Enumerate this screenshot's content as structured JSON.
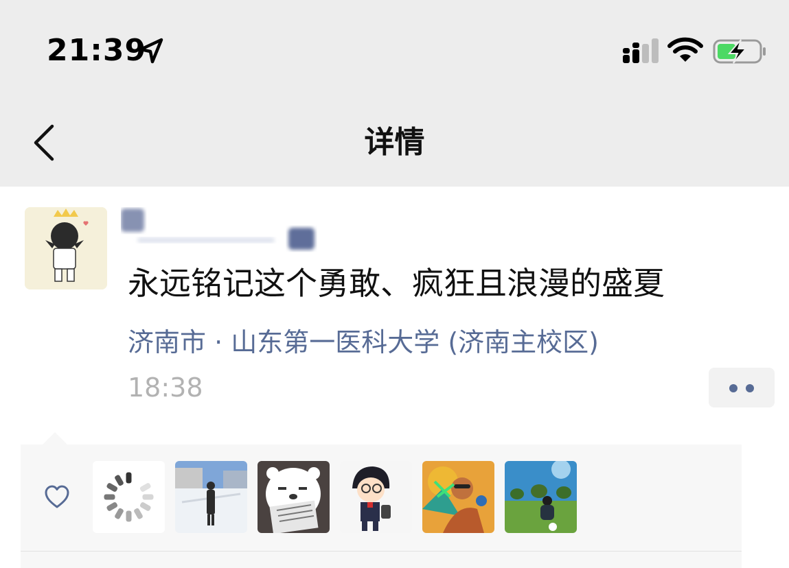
{
  "status_bar": {
    "time": "21:39",
    "location_icon": "location-arrow-icon",
    "signal_icon": "cellular-signal-icon",
    "wifi_icon": "wifi-icon",
    "battery_icon": "battery-charging-icon",
    "battery_color": "#4cd964"
  },
  "nav": {
    "back_icon": "chevron-left-icon",
    "title": "详情"
  },
  "post": {
    "text": "永远铭记这个勇敢、疯狂且浪漫的盛夏",
    "location": "济南市 · 山东第一医科大学 (济南主校区)",
    "time": "18:38",
    "more_icon": "more-dots-icon",
    "link_color": "#576b95"
  },
  "likes": {
    "heart_icon": "heart-outline-icon",
    "avatars": [
      "loading-spinner-avatar",
      "snow-photo-avatar",
      "polar-bear-avatar",
      "cartoon-boy-avatar",
      "colorful-portrait-avatar",
      "field-photo-avatar"
    ]
  }
}
